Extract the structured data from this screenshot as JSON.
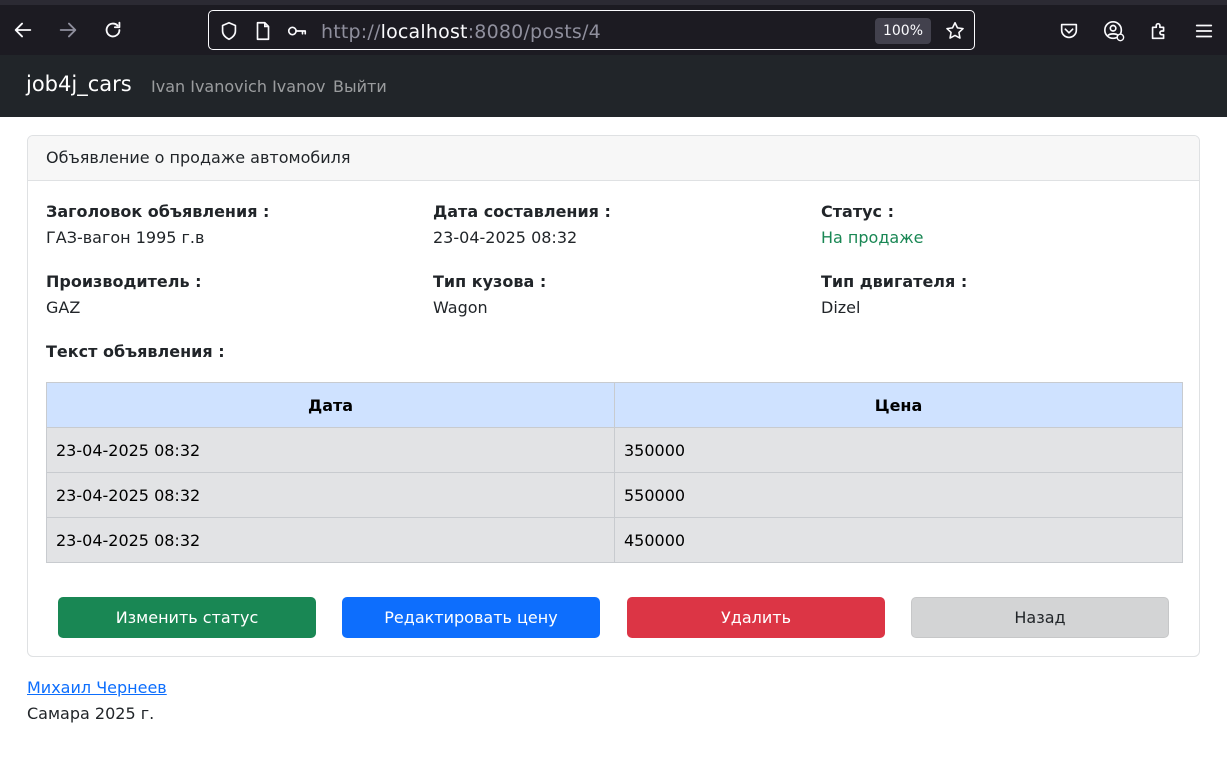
{
  "browser": {
    "url_prefix": "http://",
    "url_host": "localhost",
    "url_rest": ":8080/posts/4",
    "zoom": "100%"
  },
  "navbar": {
    "brand": "job4j_cars",
    "user_name": "Ivan Ivanovich Ivanov",
    "logout_label": "Выйти"
  },
  "card": {
    "header": "Объявление о продаже автомобиля",
    "fields": {
      "title_label": "Заголовок объявления :",
      "title_value": "ГАЗ-вагон 1995 г.в",
      "date_label": "Дата составления :",
      "date_value": "23-04-2025 08:32",
      "status_label": "Статус :",
      "status_value": "На продаже",
      "maker_label": "Производитель :",
      "maker_value": "GAZ",
      "body_label": "Тип кузова :",
      "body_value": "Wagon",
      "engine_label": "Тип двигателя :",
      "engine_value": "Dizel",
      "text_label": "Текст объявления :"
    },
    "table": {
      "headers": [
        "Дата",
        "Цена"
      ],
      "rows": [
        [
          "23-04-2025 08:32",
          "350000"
        ],
        [
          "23-04-2025 08:32",
          "550000"
        ],
        [
          "23-04-2025 08:32",
          "450000"
        ]
      ]
    },
    "buttons": {
      "change_status": "Изменить статус",
      "edit_price": "Редактировать цену",
      "delete": "Удалить",
      "back": "Назад"
    }
  },
  "footer": {
    "author_link": "Михаил Чернеев",
    "city_year": "Самара 2025 г."
  },
  "colors": {
    "status_green": "#198754",
    "primary_blue": "#0d6efd",
    "danger_red": "#dc3545",
    "table_header": "#cfe2ff",
    "table_row": "#e2e3e5"
  }
}
